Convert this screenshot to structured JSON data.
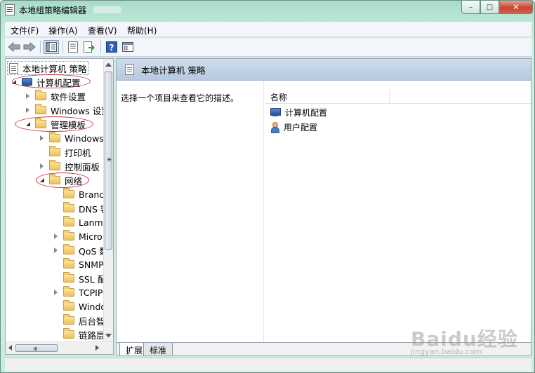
{
  "window": {
    "title": "本地组策略编辑器"
  },
  "caption": {
    "minimize": "–",
    "maximize": "□",
    "close": "✕"
  },
  "menu": [
    "文件(F)",
    "操作(A)",
    "查看(V)",
    "帮助(H)"
  ],
  "toolbar": {
    "icons": [
      "back-arrow-icon",
      "forward-arrow-icon",
      "show-tree-icon",
      "properties-icon",
      "export-list-icon",
      "help-icon",
      "extended-view-icon"
    ]
  },
  "tree": {
    "root": "本地计算机 策略",
    "computer_config": "计算机配置",
    "software_settings": "软件设置",
    "windows_settings": "Windows 设置",
    "admin_templates": "管理模板",
    "windows_components": "Windows",
    "printers": "打印机",
    "control_panel": "控制面板",
    "network": "网络",
    "network_children": [
      "Branch",
      "DNS 客",
      "Lanma",
      "Micro",
      "QoS 数",
      "SNMP",
      "SSL 配",
      "TCPIP",
      "Windo",
      "后台智",
      "链路层"
    ]
  },
  "right_pane": {
    "header": "本地计算机 策略",
    "description": "选择一个项目来查看它的描述。",
    "column_name": "名称",
    "items": [
      "计算机配置",
      "用户配置"
    ]
  },
  "tabs": {
    "extended": "扩展",
    "standard": "标准"
  },
  "watermark": {
    "main": "Baidu经验",
    "sub": "jingyan.baidu.com"
  },
  "colors": {
    "annotation": "#d0323a",
    "frame": "#b9e6d4",
    "header_band": "#b7c9e0"
  }
}
